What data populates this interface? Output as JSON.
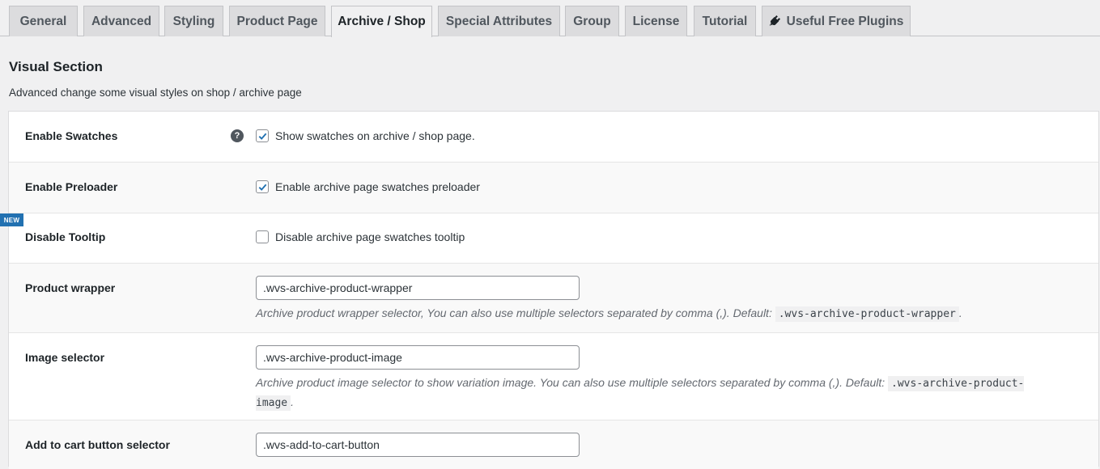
{
  "tabs": [
    {
      "label": "General"
    },
    {
      "label": "Advanced"
    },
    {
      "label": "Styling"
    },
    {
      "label": "Product Page"
    },
    {
      "label": "Archive / Shop",
      "active": true
    },
    {
      "label": "Special Attributes"
    },
    {
      "label": "Group"
    },
    {
      "label": "License"
    },
    {
      "label": "Tutorial"
    },
    {
      "label": "Useful Free Plugins",
      "icon": "plug-icon"
    }
  ],
  "section": {
    "title": "Visual Section",
    "description": "Advanced change some visual styles on shop / archive page"
  },
  "settings": {
    "enable_swatches": {
      "label": "Enable Swatches",
      "help": "?",
      "checked": true,
      "text": "Show swatches on archive / shop page."
    },
    "enable_preloader": {
      "label": "Enable Preloader",
      "checked": true,
      "text": "Enable archive page swatches preloader"
    },
    "disable_tooltip": {
      "badge": "NEW",
      "label": "Disable Tooltip",
      "checked": false,
      "text": "Disable archive page swatches tooltip"
    },
    "product_wrapper": {
      "label": "Product wrapper",
      "value": ".wvs-archive-product-wrapper",
      "desc_text": "Archive product wrapper selector, You can also use multiple selectors separated by comma (,). Default:",
      "default_code": ".wvs-archive-product-wrapper",
      "desc_end": "."
    },
    "image_selector": {
      "label": "Image selector",
      "value": ".wvs-archive-product-image",
      "desc_text": "Archive product image selector to show variation image. You can also use multiple selectors separated by comma (,). Default:",
      "default_code": ".wvs-archive-product-image",
      "desc_end": "."
    },
    "add_to_cart": {
      "label": "Add to cart button selector",
      "value": ".wvs-add-to-cart-button"
    }
  },
  "colors": {
    "accent": "#2271b1",
    "checkmark": "#2271b1"
  }
}
